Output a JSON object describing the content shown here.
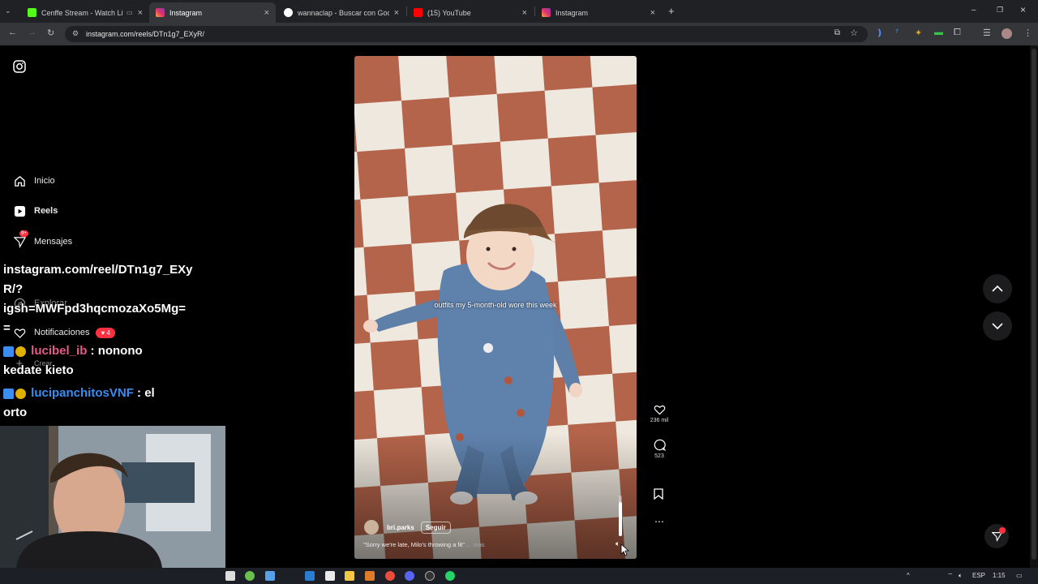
{
  "browser": {
    "tabs": [
      {
        "title": "Cenffe Stream - Watch Live",
        "active": false,
        "color": "#53fc18"
      },
      {
        "title": "Instagram",
        "active": true,
        "color": "#e1306c"
      },
      {
        "title": "wannaclap - Buscar con Google",
        "active": false,
        "color": "#4285f4"
      },
      {
        "title": "(15) YouTube",
        "active": false,
        "color": "#ff0000"
      },
      {
        "title": "Instagram",
        "active": false,
        "color": "#e1306c"
      }
    ],
    "url": "instagram.com/reels/DTn1g7_EXyR/"
  },
  "sidebar": {
    "items": [
      {
        "label": "Inicio",
        "icon": "home-icon"
      },
      {
        "label": "Reels",
        "icon": "reels-icon"
      },
      {
        "label": "Mensajes",
        "icon": "messages-icon",
        "badge": "9+"
      },
      {
        "label": "Explorar",
        "icon": "explore-icon"
      },
      {
        "label": "Notificaciones",
        "icon": "heart-icon",
        "count": "4"
      },
      {
        "label": "Crear",
        "icon": "plus-icon"
      }
    ]
  },
  "chat": {
    "line1": "instagram.com/reel/DTn1g7_EXy",
    "line2": "R/?",
    "line3": "igsh=MWFpd3hqcmozaXo5Mg=",
    "line4": "=",
    "msg1_user": "lucibel_ib",
    "msg1_text": ": nonono",
    "msg1_cont": "kedate kieto",
    "msg2_user": "lucipanchitosVNF",
    "msg2_text": ": el",
    "msg2_cont": "orto"
  },
  "reel": {
    "overlay_text": "outfits my 5-month-old wore this week",
    "author": "bri.parks",
    "follow_label": "Seguir",
    "caption": "\"Sorry we're late, Milo's throwing a fit\"",
    "more_label": "... más",
    "likes": "236 mil",
    "comments": "523",
    "volume_level": 0.85
  },
  "taskbar": {
    "lang": "ESP",
    "time": "1:15"
  }
}
